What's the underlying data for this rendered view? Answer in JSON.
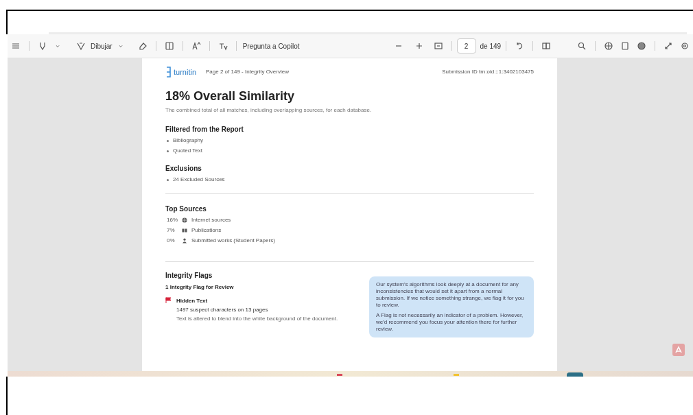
{
  "toolbar": {
    "draw_label": "Dibujar",
    "copilot_label": "Pregunta a Copilot",
    "page_number": "2",
    "page_total": "de 149"
  },
  "document": {
    "brand": "turnitin",
    "page_info": "Page 2 of 149 - Integrity Overview",
    "submission_id": "Submission ID   trn:oid:::1:3402103475",
    "title": "18% Overall Similarity",
    "subtitle": "The combined total of all matches, including overlapping sources, for each database.",
    "filtered": {
      "heading": "Filtered from the Report",
      "items": [
        "Bibliography",
        "Quoted Text"
      ]
    },
    "exclusions": {
      "heading": "Exclusions",
      "items": [
        "24 Excluded Sources"
      ]
    },
    "top_sources": {
      "heading": "Top Sources",
      "items": [
        {
          "percent": "16%",
          "kind": "globe",
          "label": "Internet sources"
        },
        {
          "percent": "7%",
          "kind": "book",
          "label": "Publications"
        },
        {
          "percent": "0%",
          "kind": "person",
          "label": "Submitted works (Student Papers)"
        }
      ]
    },
    "flags": {
      "heading": "Integrity Flags",
      "count": "1 Integrity Flag for Review",
      "flag_title": "Hidden Text",
      "flag_detail": "1497 suspect characters on 13 pages",
      "flag_description": "Text is altered to blend into the white background of the document.",
      "note": [
        "Our system's algorithms look deeply at a document for any inconsistencies that would set it apart from a normal submission. If we notice something strange, we flag it for you to review.",
        "A Flag is not necessarily an indicator of a problem. However, we'd recommend you focus your attention there for further review."
      ]
    }
  }
}
